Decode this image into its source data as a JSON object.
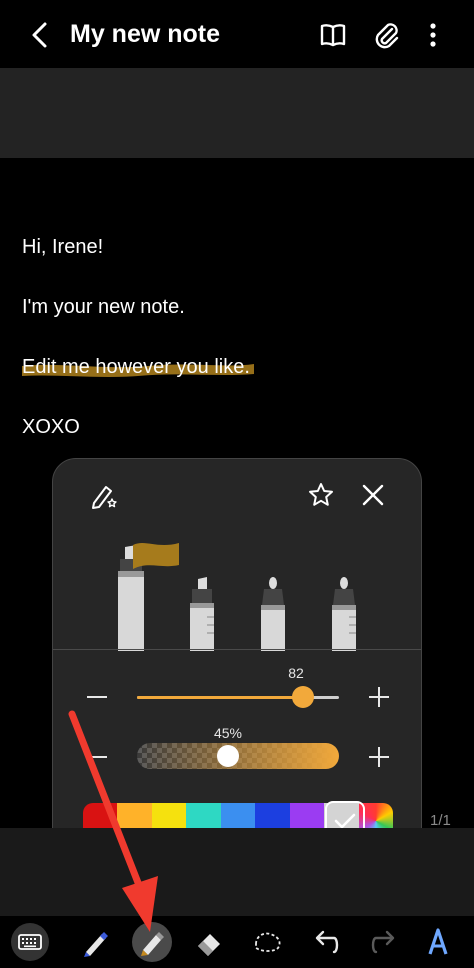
{
  "header": {
    "title": "My new note",
    "icons": [
      "back-icon",
      "book-icon",
      "paperclip-icon",
      "more-vertical-icon"
    ]
  },
  "note": {
    "lines": [
      "Hi, Irene!",
      "I'm your new note.",
      "Edit me however you like.",
      "XOXO"
    ],
    "highlight_color": "#a67b1c"
  },
  "pen_panel": {
    "size_value": "82",
    "size_fraction": 0.82,
    "opacity_value": "45%",
    "opacity_fraction": 0.45,
    "accent_color": "#f2a93b",
    "colors": [
      "#d91212",
      "#ffb229",
      "#f5e10e",
      "#2ed8c3",
      "#3b8ff0",
      "#1c3fe0",
      "#9b3cf2",
      "#d4d4d4"
    ],
    "selected_color_index": 8,
    "page_dots": 5,
    "active_dot": 1
  },
  "page_indicator": "1/1",
  "toolbar": {
    "tools": [
      "keyboard-icon",
      "pen-icon",
      "highlighter-icon",
      "eraser-icon",
      "lasso-icon",
      "undo-icon",
      "redo-icon",
      "ai-text-icon"
    ],
    "selected": "highlighter-icon"
  }
}
